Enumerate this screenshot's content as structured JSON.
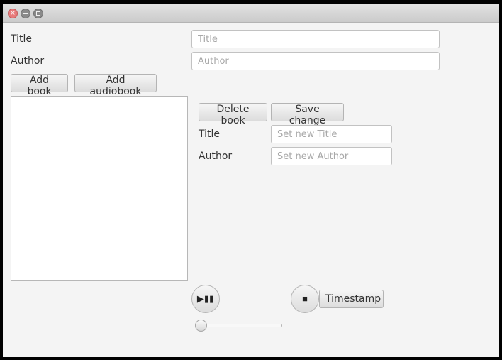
{
  "window": {
    "controls": [
      "close-icon",
      "minimize-icon",
      "maximize-icon"
    ]
  },
  "form": {
    "title_label": "Title",
    "title_placeholder": "Title",
    "title_value": "",
    "author_label": "Author",
    "author_placeholder": "Author",
    "author_value": ""
  },
  "actions": {
    "add_book": "Add book",
    "add_audiobook": "Add audiobook"
  },
  "book_list": {
    "items": []
  },
  "editor": {
    "delete_book": "Delete book",
    "save_change": "Save change",
    "title_label": "Title",
    "title_placeholder": "Set new Title",
    "author_label": "Author",
    "author_placeholder": "Set new Author"
  },
  "player": {
    "play_pause_glyph": "▶▮▮",
    "stop_glyph": "■",
    "timestamp_label": "Timestamp",
    "progress": 0
  },
  "colors": {
    "close": "#e87b7b",
    "window_bg": "#f4f4f4"
  }
}
